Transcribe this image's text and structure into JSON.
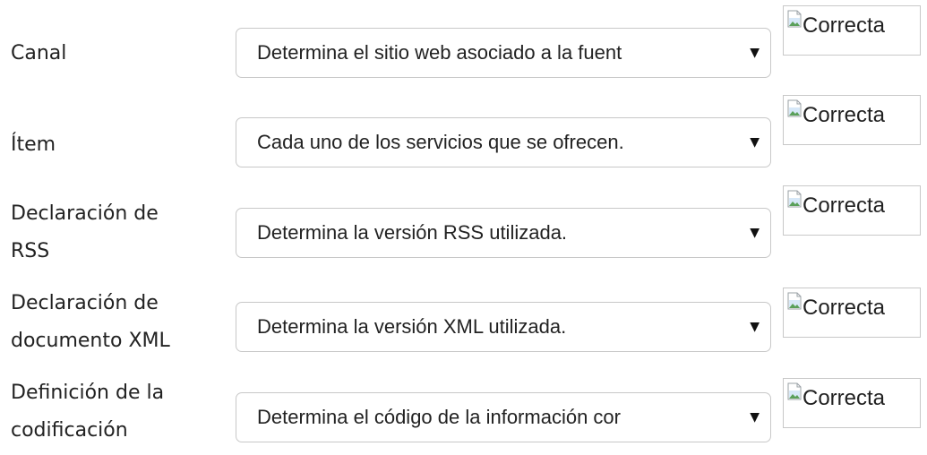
{
  "rows": [
    {
      "label": "Canal",
      "select_value": "Determina el sitio web asociado a la fuent",
      "result_icon": "broken-image-icon",
      "result_text": "Correcta"
    },
    {
      "label": "Ítem",
      "select_value": "Cada uno de los servicios que se ofrecen.",
      "result_icon": "broken-image-icon",
      "result_text": "Correcta"
    },
    {
      "label": "Declaración de\nRSS",
      "select_value": "Determina la versión RSS utilizada.",
      "result_icon": "broken-image-icon",
      "result_text": "Correcta"
    },
    {
      "label": "Declaración de\ndocumento XML",
      "select_value": "Determina la versión XML utilizada.",
      "result_icon": "broken-image-icon",
      "result_text": "Correcta"
    },
    {
      "label": "Definición de la\ncodificación",
      "select_value": "Determina el código de la información cor",
      "result_icon": "broken-image-icon",
      "result_text": "Correcta"
    }
  ],
  "dropdown_icon": "triangle-down-icon"
}
